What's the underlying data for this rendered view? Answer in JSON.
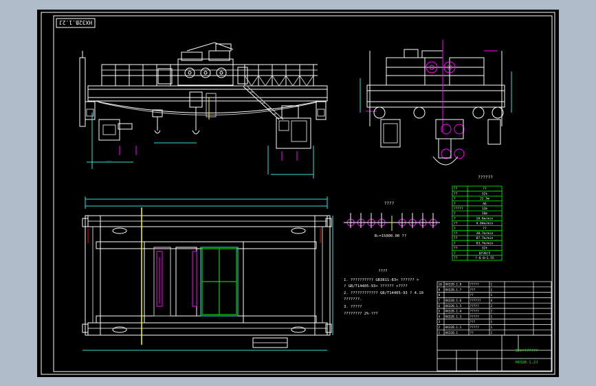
{
  "drawing": {
    "id_stamp": "HX32B.1.2J",
    "title_code": "HX32B.1.2J",
    "title_name": "32t???????"
  },
  "labels": {
    "pulley_title": "????",
    "pulley_formula": "B₁=15000.00 ??",
    "params_title": "??????",
    "notes_title": "????",
    "note_1": "1. ??????????   GB3811-83< ??????  >",
    "note_1b": "   ? GB/T14405-93< ??????  >????",
    "note_2": "2. ????????????      GB/T14405-93 ? 4.10",
    "note_2b": "   ???????.",
    "note_3": "3. ?????",
    "note_3b": "   ???????? 2%·???"
  },
  "params_table": {
    "header": [
      "??",
      "??"
    ],
    "rows": [
      [
        "??",
        "32t"
      ],
      [
        "?",
        "22.5m"
      ],
      [
        "?",
        "A6"
      ],
      [
        "?????",
        "12m"
      ],
      [
        "?",
        "16m"
      ],
      [
        "?",
        "10.6m/min"
      ],
      [
        "??",
        "4.04m/min"
      ],
      [
        "?",
        "??"
      ],
      [
        "??",
        "38.7m/min"
      ],
      [
        "??",
        "87.7m/min"
      ],
      [
        "?",
        "83.7m/min"
      ],
      [
        "??",
        "32t"
      ],
      [
        "?",
        "QY38/5"
      ],
      [
        "??",
        "?-0.0~1.55"
      ]
    ]
  },
  "bom": {
    "rows": [
      [
        "10",
        "HX32B.1.8",
        "?????",
        "1",
        "",
        ""
      ],
      [
        "9",
        "HX32B.1.7",
        "???",
        "1",
        "",
        ""
      ],
      [
        "8",
        "",
        "??",
        "1",
        "",
        ""
      ],
      [
        "7",
        "HX32B.1.6",
        "??????",
        "4",
        "",
        ""
      ],
      [
        "6",
        "HX32B.1.5",
        "?????",
        "2",
        "",
        ""
      ],
      [
        "5",
        "HX32B.1.4",
        "?????",
        "2",
        "",
        ""
      ],
      [
        "4",
        "HX32B.1.3",
        "?????",
        "1",
        "",
        ""
      ],
      [
        "3",
        "",
        "???",
        "1",
        "",
        ""
      ],
      [
        "2",
        "HX32B.1.1",
        "?????",
        "1",
        "",
        ""
      ],
      [
        "1",
        "HX32B.1",
        "??",
        "1",
        "",
        ""
      ]
    ]
  }
}
